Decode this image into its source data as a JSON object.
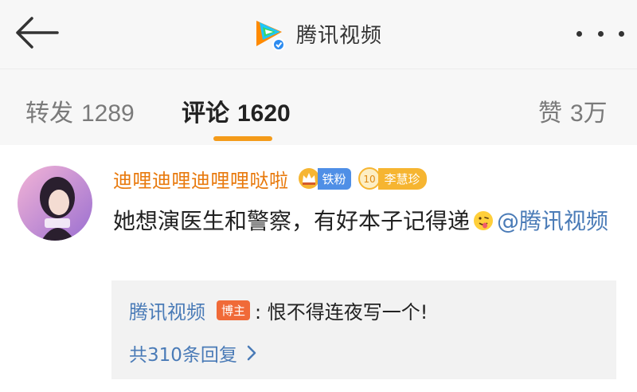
{
  "header": {
    "title": "腾讯视频",
    "back_icon": "back-arrow-icon",
    "more_icon": "more-dots-icon"
  },
  "tabs": [
    {
      "label": "转发",
      "count": "1289"
    },
    {
      "label": "评论",
      "count": "1620"
    },
    {
      "label": "赞",
      "count": "3万"
    }
  ],
  "comment": {
    "username": "迪哩迪哩迪哩哩哒啦",
    "fan_badge": "铁粉",
    "star_badge_level": "10",
    "star_badge": "李慧珍",
    "text": "她想演医生和警察，有好本子记得递",
    "mention": "@腾讯视频",
    "reply": {
      "author": "腾讯视频",
      "host_label": "博主",
      "text": ": 恨不得连夜写一个!",
      "count_label": "共310条回复"
    }
  },
  "colors": {
    "accent_orange": "#f49b1a",
    "username": "#e8790c",
    "link_blue": "#4a7bb7",
    "fan_blue": "#4f8fe6",
    "host_red": "#f06a38"
  }
}
